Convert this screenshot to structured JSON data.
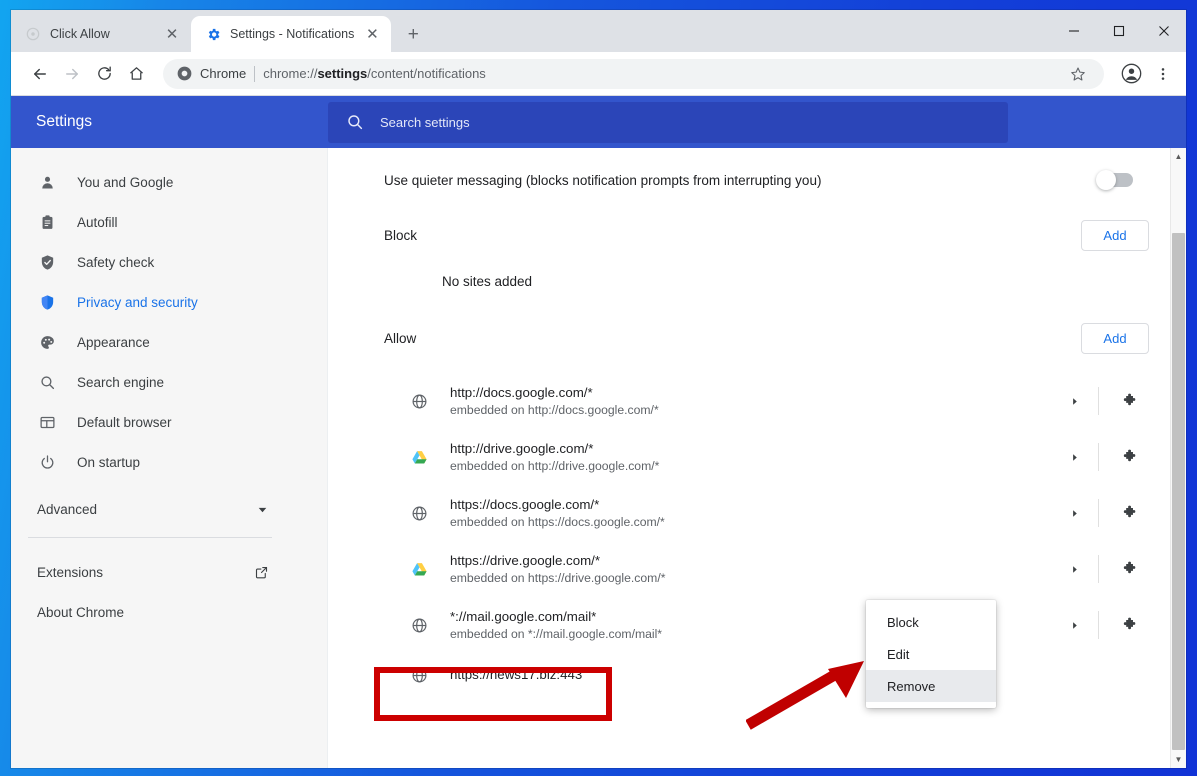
{
  "window": {
    "controls": [
      {
        "name": "minimize",
        "glyph": "─"
      },
      {
        "name": "maximize",
        "glyph": "□"
      },
      {
        "name": "close",
        "glyph": "✕"
      }
    ]
  },
  "tabs": [
    {
      "title": "Click Allow",
      "favicon": "generic-globe-icon",
      "active": false,
      "close": "✕"
    },
    {
      "title": "Settings - Notifications",
      "favicon": "settings-gear-icon",
      "active": true,
      "close": "✕"
    }
  ],
  "new_tab_label": "+",
  "toolbar": {
    "back_icon": "back-arrow-icon",
    "forward_icon": "forward-arrow-icon",
    "reload_icon": "reload-icon",
    "home_icon": "home-icon",
    "chrome_label": "Chrome",
    "url_prefix": "chrome://",
    "url_bold": "settings",
    "url_suffix": "/content/notifications",
    "url_full": "chrome://settings/content/notifications",
    "bookmark_icon": "star-icon",
    "profile_icon": "account-avatar-icon",
    "menu_icon": "three-dot-menu-icon"
  },
  "settings_header": {
    "title": "Settings",
    "search_placeholder": "Search settings",
    "search_icon": "search-icon",
    "bg_color": "#3355cc"
  },
  "sidebar": {
    "items": [
      {
        "label": "You and Google",
        "icon": "person-icon",
        "selected": false
      },
      {
        "label": "Autofill",
        "icon": "clipboard-icon",
        "selected": false
      },
      {
        "label": "Safety check",
        "icon": "shield-check-icon",
        "selected": false
      },
      {
        "label": "Privacy and security",
        "icon": "shield-blue-icon",
        "selected": true
      },
      {
        "label": "Appearance",
        "icon": "palette-icon",
        "selected": false
      },
      {
        "label": "Search engine",
        "icon": "search-icon",
        "selected": false
      },
      {
        "label": "Default browser",
        "icon": "browser-window-icon",
        "selected": false
      },
      {
        "label": "On startup",
        "icon": "power-icon",
        "selected": false
      }
    ],
    "advanced": {
      "label": "Advanced",
      "icon": "chevron-down-icon"
    },
    "extensions": {
      "label": "Extensions",
      "icon": "external-link-icon"
    },
    "about": {
      "label": "About Chrome"
    },
    "selected_color": "#1a73e8"
  },
  "main": {
    "quieter_messaging": {
      "label": "Use quieter messaging (blocks notification prompts from interrupting you)",
      "toggle_state": "off"
    },
    "block_section": {
      "title": "Block",
      "add_label": "Add",
      "empty_text": "No sites added"
    },
    "allow_section": {
      "title": "Allow",
      "add_label": "Add"
    },
    "sites": [
      {
        "url": "http://docs.google.com/*",
        "embedded": "embedded on http://docs.google.com/*",
        "favicon": "globe-icon",
        "arrow": "expand-arrow-icon",
        "extension": "puzzle-piece-icon"
      },
      {
        "url": "http://drive.google.com/*",
        "embedded": "embedded on http://drive.google.com/*",
        "favicon": "drive-icon",
        "arrow": "expand-arrow-icon",
        "extension": "puzzle-piece-icon"
      },
      {
        "url": "https://docs.google.com/*",
        "embedded": "embedded on https://docs.google.com/*",
        "favicon": "globe-icon",
        "arrow": "expand-arrow-icon",
        "extension": "puzzle-piece-icon"
      },
      {
        "url": "https://drive.google.com/*",
        "embedded": "embedded on https://drive.google.com/*",
        "favicon": "drive-icon",
        "arrow": "expand-arrow-icon",
        "extension": "puzzle-piece-icon"
      },
      {
        "url": "*://mail.google.com/mail*",
        "embedded": "embedded on *://mail.google.com/mail*",
        "favicon": "globe-icon",
        "arrow": "expand-arrow-icon",
        "extension": "puzzle-piece-icon"
      },
      {
        "url": "https://news17.biz:443",
        "embedded": "",
        "favicon": "globe-icon",
        "arrow": "",
        "extension": "",
        "highlighted": true
      }
    ]
  },
  "context_menu": {
    "items": [
      {
        "label": "Block",
        "hover": false
      },
      {
        "label": "Edit",
        "hover": false
      },
      {
        "label": "Remove",
        "hover": true
      }
    ]
  },
  "annotations": {
    "highlight_color": "#cc0000",
    "arrow_color": "#c00000",
    "arrow_target": "Remove"
  },
  "scrollbar": {
    "up_arrow": "▲",
    "down_arrow": "▼"
  }
}
